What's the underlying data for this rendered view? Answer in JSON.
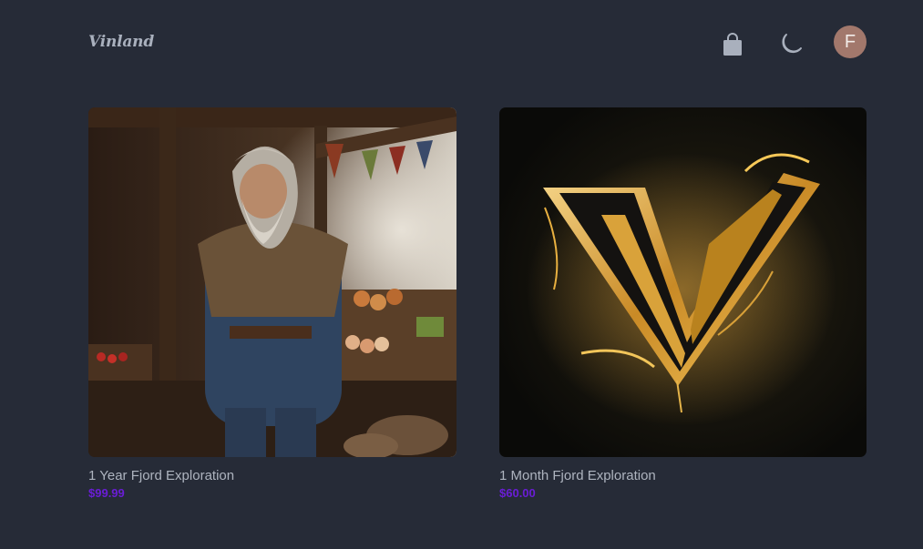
{
  "header": {
    "brand": "Vinland",
    "cart_icon": "shopping-bag-icon",
    "theme_icon": "moon-icon",
    "avatar_initial": "F"
  },
  "products": [
    {
      "title": "1 Year Fjord Exploration",
      "price": "$99.99",
      "image": "viking-market-image"
    },
    {
      "title": "1 Month Fjord Exploration",
      "price": "$60.00",
      "image": "golden-v-logo-image"
    }
  ],
  "colors": {
    "background": "#262b37",
    "price": "#6a1dd6",
    "text": "#aeb4bf",
    "avatar": "#a2786c"
  }
}
